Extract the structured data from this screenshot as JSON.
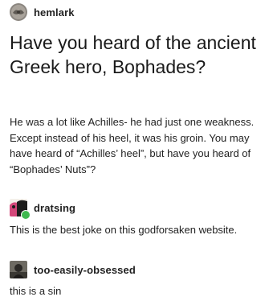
{
  "post": {
    "author": {
      "username": "hemlark",
      "avatar_icon": "gray-moth-avatar"
    },
    "title": "Have you heard of the ancient Greek hero, Bophades?",
    "body": "He was a lot like Achilles- he had just one weakness. Except instead of his heel, it was his groin. You may have heard of “Achilles’ heel”, but have you heard of “Bophades’ Nuts”?"
  },
  "replies": [
    {
      "username": "dratsing",
      "avatar_icon": "pink-black-avatar",
      "text": "This is the best joke on this godforsaken website."
    },
    {
      "username": "too-easily-obsessed",
      "avatar_icon": "dark-figure-avatar",
      "text": "this is a sin"
    }
  ],
  "colors": {
    "text": "#222222",
    "background": "#ffffff",
    "badge": "#3fb950"
  }
}
